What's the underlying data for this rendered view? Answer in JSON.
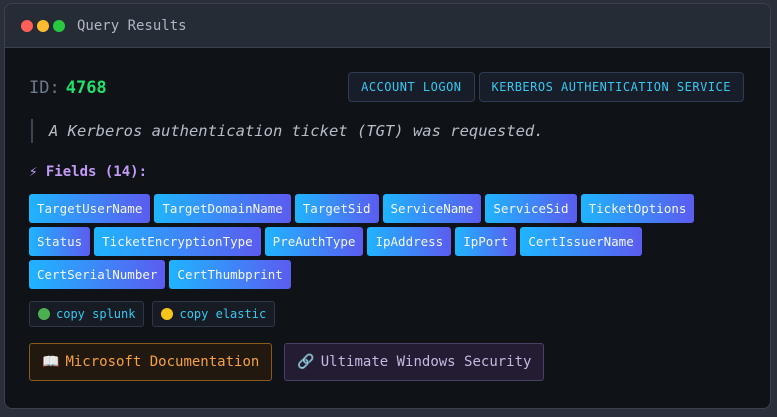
{
  "window": {
    "title": "Query Results"
  },
  "event": {
    "id_label": "ID:",
    "id_value": "4768",
    "tags": [
      "ACCOUNT LOGON",
      "KERBEROS AUTHENTICATION SERVICE"
    ],
    "description": "A Kerberos authentication ticket (TGT) was requested."
  },
  "fields": {
    "heading": "Fields (14):",
    "heading_icon": "lightning-icon",
    "items": [
      "TargetUserName",
      "TargetDomainName",
      "TargetSid",
      "ServiceName",
      "ServiceSid",
      "TicketOptions",
      "Status",
      "TicketEncryptionType",
      "PreAuthType",
      "IpAddress",
      "IpPort",
      "CertIssuerName",
      "CertSerialNumber",
      "CertThumbprint"
    ]
  },
  "copy_buttons": [
    {
      "label": "copy splunk",
      "icon": "green-circle-icon"
    },
    {
      "label": "copy elastic",
      "icon": "yellow-circle-icon"
    }
  ],
  "links": [
    {
      "label": "Microsoft Documentation",
      "icon": "book-icon"
    },
    {
      "label": "Ultimate Windows Security",
      "icon": "link-icon"
    }
  ],
  "colors": {
    "accent_cyan": "#35c8f0",
    "id_green": "#22e06b",
    "heading_purple": "#c39af5",
    "field_gradient_start": "#1fb4ff",
    "field_gradient_end": "#5b5cf0"
  }
}
